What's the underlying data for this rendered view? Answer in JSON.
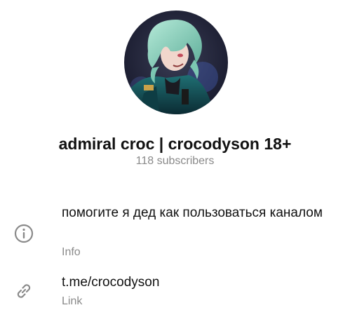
{
  "channel": {
    "name": "admiral croc | crocodyson 18+",
    "subscribers": "118 subscribers",
    "avatar_icon": "channel-avatar"
  },
  "info": {
    "text": "помогите я дед как пользоваться каналом",
    "label": "Info",
    "icon": "info-icon"
  },
  "link": {
    "text": "t.me/crocodyson",
    "label": "Link",
    "icon": "link-icon"
  },
  "colors": {
    "text_primary": "#111111",
    "text_secondary": "#8a8a8a",
    "icon": "#8a8a8a"
  }
}
